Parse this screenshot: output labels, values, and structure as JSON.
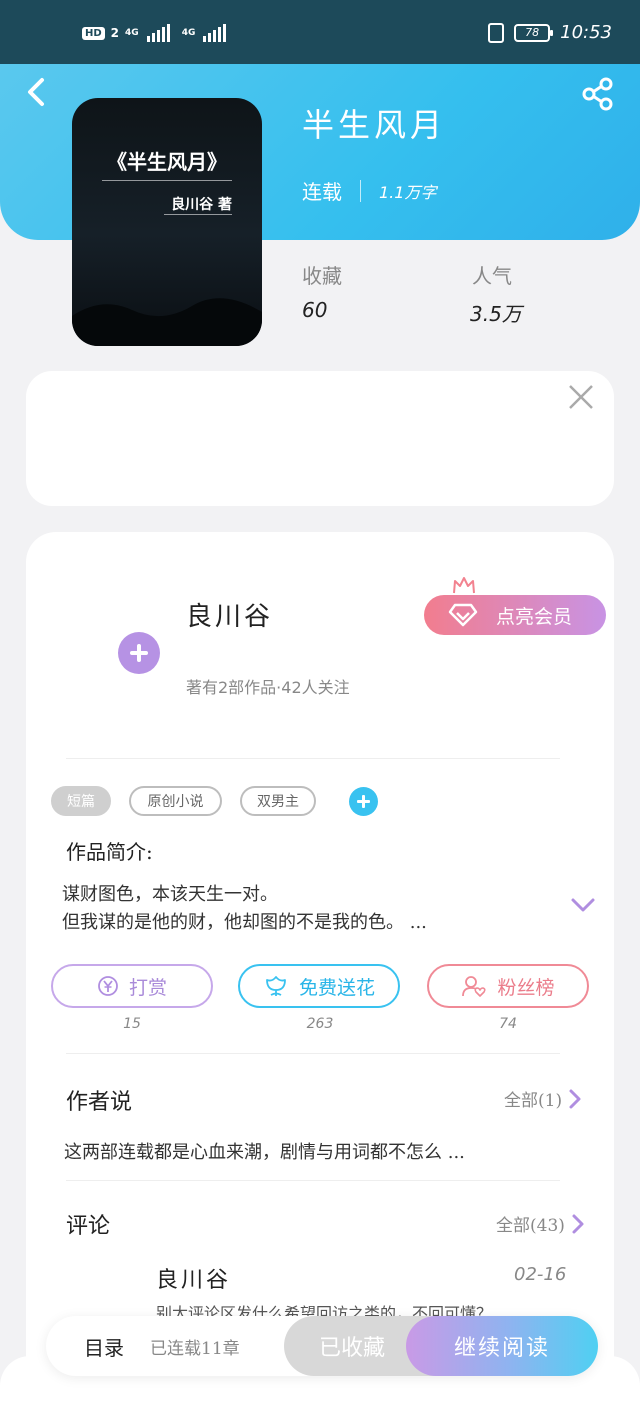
{
  "status_bar": {
    "hd": "HD",
    "sim1": "2",
    "network1": "4G",
    "network2": "4G",
    "battery": "78",
    "time": "10:53"
  },
  "book": {
    "title": "半生风月",
    "status": "连载",
    "word_count": "1.1万字",
    "cover_title": "《半生风月》",
    "cover_author": "良川谷 著",
    "stats": {
      "collect_label": "收藏",
      "collect_value": "60",
      "popularity_label": "人气",
      "popularity_value": "3.5万"
    }
  },
  "author": {
    "name": "良川谷",
    "summary": "著有2部作品·42人关注",
    "vip_button": "点亮会员"
  },
  "tags": [
    "短篇",
    "原创小说",
    "双男主"
  ],
  "intro": {
    "label": "作品简介:",
    "line1": "谋财图色，本该天生一对。",
    "line2": "但我谋的是他的财，他却图的不是我的色。 ..."
  },
  "actions": [
    {
      "label": "打赏",
      "count": "15",
      "icon": "yen-coin-icon",
      "color": "#b08ee0"
    },
    {
      "label": "免费送花",
      "count": "263",
      "icon": "flower-icon",
      "color": "#39c2f0"
    },
    {
      "label": "粉丝榜",
      "count": "74",
      "icon": "fan-heart-icon",
      "color": "#f08a96"
    }
  ],
  "author_says": {
    "title": "作者说",
    "more": "全部(1)",
    "text": "这两部连载都是心血来潮，剧情与用词都不怎么 ..."
  },
  "comments": {
    "title": "评论",
    "more": "全部(43)",
    "first": {
      "user": "良川谷",
      "date": "02-16",
      "text": "别太评论区发什么希望回访之类的，不回可懂？"
    }
  },
  "bottom_bar": {
    "toc": "目录",
    "toc_sub": "已连载11章",
    "collected": "已收藏",
    "continue": "继续阅读"
  },
  "colors": {
    "header": "#35bfee",
    "accent_purple": "#b692e4",
    "accent_blue": "#39c2f0",
    "accent_pink": "#f08a96"
  }
}
